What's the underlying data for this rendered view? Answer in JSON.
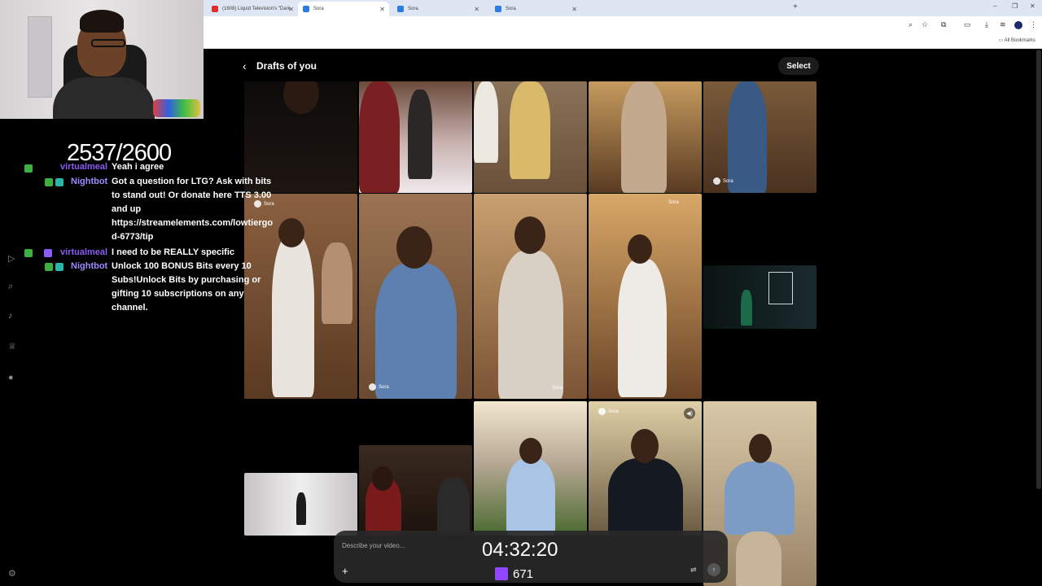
{
  "browser": {
    "tabs": [
      {
        "title": "(1608) Liquid Television's \"Dark"
      },
      {
        "title": "Sora"
      },
      {
        "title": "Sora"
      },
      {
        "title": "Sora"
      }
    ],
    "bookmarks_label": "All Bookmarks"
  },
  "page": {
    "title": "Drafts of you",
    "select_label": "Select"
  },
  "thumbnails": {
    "watermark": "Sora"
  },
  "prompt": {
    "placeholder": "Describe your video..."
  },
  "stream": {
    "counter": "2537/2600",
    "timer": "04:32:20",
    "sub_count": "671",
    "chat": [
      {
        "user": "virtualmeal",
        "text": "Yeah i agree"
      },
      {
        "user": "Nightbot",
        "lines": [
          "Got a question for LTG? Ask with bits",
          "to stand out! Or donate here TTS 3.00",
          "and up",
          "https://streamelements.com/lowtiergo",
          "d-6773/tip"
        ]
      },
      {
        "user": "virtualmeal",
        "text": "I need to be REALLY specific"
      },
      {
        "user": "Nightbot",
        "lines": [
          "Unlock 100 BONUS Bits every 10",
          "Subs!Unlock Bits by purchasing or",
          "gifting 10 subscriptions on any",
          "channel."
        ]
      }
    ]
  },
  "colors": {
    "twitch_purple": "#9146ff",
    "chat_user": "#9b8cff",
    "chrome_bg": "#dfe6f3"
  }
}
